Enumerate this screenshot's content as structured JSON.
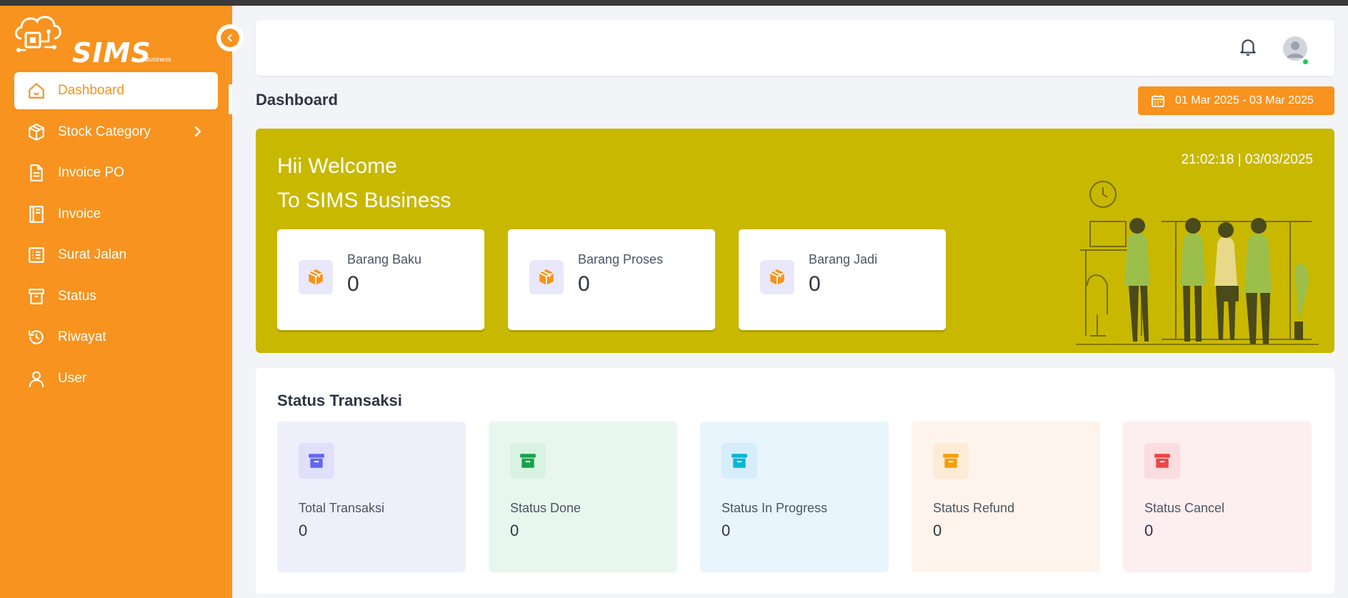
{
  "app": {
    "logo_text": "SIMS",
    "logo_sub": "Business"
  },
  "sidebar": {
    "items": [
      {
        "label": "Dashboard",
        "icon": "home-icon",
        "active": true
      },
      {
        "label": "Stock Category",
        "icon": "box-icon",
        "has_submenu": true
      },
      {
        "label": "Invoice PO",
        "icon": "document-icon"
      },
      {
        "label": "Invoice",
        "icon": "book-icon"
      },
      {
        "label": "Surat Jalan",
        "icon": "list-icon"
      },
      {
        "label": "Status",
        "icon": "archive-icon"
      },
      {
        "label": "Riwayat",
        "icon": "history-icon"
      },
      {
        "label": "User",
        "icon": "user-icon"
      }
    ]
  },
  "header": {
    "page_title": "Dashboard",
    "date_range": "01 Mar 2025 - 03 Mar 2025"
  },
  "banner": {
    "line1": "Hii Welcome",
    "line2": "To SIMS Business",
    "clock": "21:02:18 | 03/03/2025",
    "stock_cards": [
      {
        "label": "Barang Baku",
        "value": "0"
      },
      {
        "label": "Barang Proses",
        "value": "0"
      },
      {
        "label": "Barang Jadi",
        "value": "0"
      }
    ]
  },
  "status": {
    "title": "Status Transaksi",
    "cards": [
      {
        "label": "Total Transaksi",
        "value": "0",
        "bg": "#efeffb",
        "icon_bg": "#e1e0fa",
        "icon_color": "#6366f1"
      },
      {
        "label": "Status Done",
        "value": "0",
        "bg": "#e8f7ee",
        "icon_bg": "#d9f3e2",
        "icon_color": "#16a34a"
      },
      {
        "label": "Status In Progress",
        "value": "0",
        "bg": "#e8f5fd",
        "icon_bg": "#d6eefb",
        "icon_color": "#06b6d4"
      },
      {
        "label": "Status Refund",
        "value": "0",
        "bg": "#fef4ec",
        "icon_bg": "#fdebd6",
        "icon_color": "#f59e0b"
      },
      {
        "label": "Status Cancel",
        "value": "0",
        "bg": "#fdeef0",
        "icon_bg": "#fbdcdf",
        "icon_color": "#ef4444"
      }
    ]
  },
  "colors": {
    "accent": "#f7931e",
    "banner": "#c9b800"
  }
}
